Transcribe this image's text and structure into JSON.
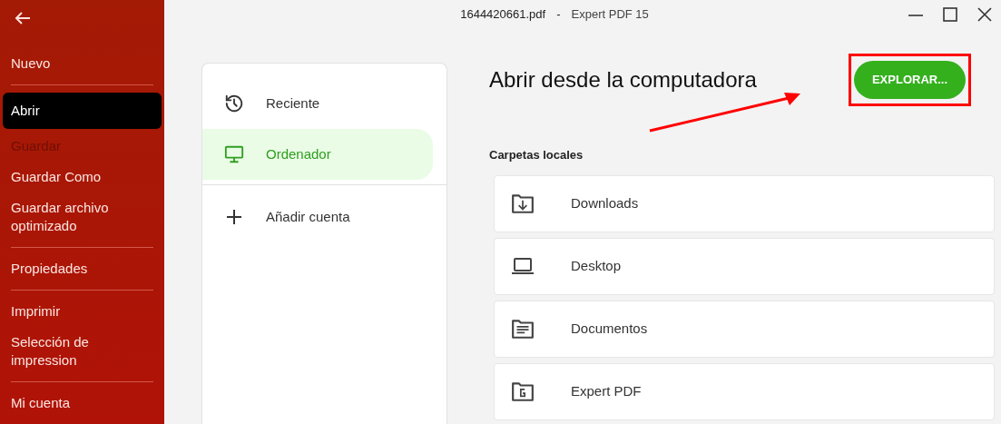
{
  "window": {
    "file_name": "1644420661.pdf",
    "separator": "-",
    "app_name": "Expert PDF 15"
  },
  "sidebar": {
    "groups": [
      [
        {
          "label": "Nuevo",
          "selected": false,
          "disabled": false
        }
      ],
      [
        {
          "label": "Abrir",
          "selected": true,
          "disabled": false
        },
        {
          "label": "Guardar",
          "selected": false,
          "disabled": true
        },
        {
          "label": "Guardar Como",
          "selected": false,
          "disabled": false
        },
        {
          "label": "Guardar archivo optimizado",
          "selected": false,
          "disabled": false
        }
      ],
      [
        {
          "label": "Propiedades",
          "selected": false,
          "disabled": false
        }
      ],
      [
        {
          "label": "Imprimir",
          "selected": false,
          "disabled": false
        },
        {
          "label": "Selección de impression",
          "selected": false,
          "disabled": false
        }
      ],
      [
        {
          "label": "Mi cuenta",
          "selected": false,
          "disabled": false
        }
      ]
    ]
  },
  "locations": [
    {
      "label": "Reciente",
      "kind": "recent",
      "selected": false
    },
    {
      "label": "Ordenador",
      "kind": "computer",
      "selected": true
    },
    {
      "label": "Añadir cuenta",
      "kind": "add",
      "selected": false
    }
  ],
  "main": {
    "title": "Abrir desde la computadora",
    "browse_button": "EXPLORAR...",
    "section": "Carpetas locales",
    "folders": [
      {
        "label": "Downloads",
        "kind": "downloads"
      },
      {
        "label": "Desktop",
        "kind": "desktop"
      },
      {
        "label": "Documentos",
        "kind": "documents"
      },
      {
        "label": "Expert PDF",
        "kind": "app"
      }
    ]
  }
}
